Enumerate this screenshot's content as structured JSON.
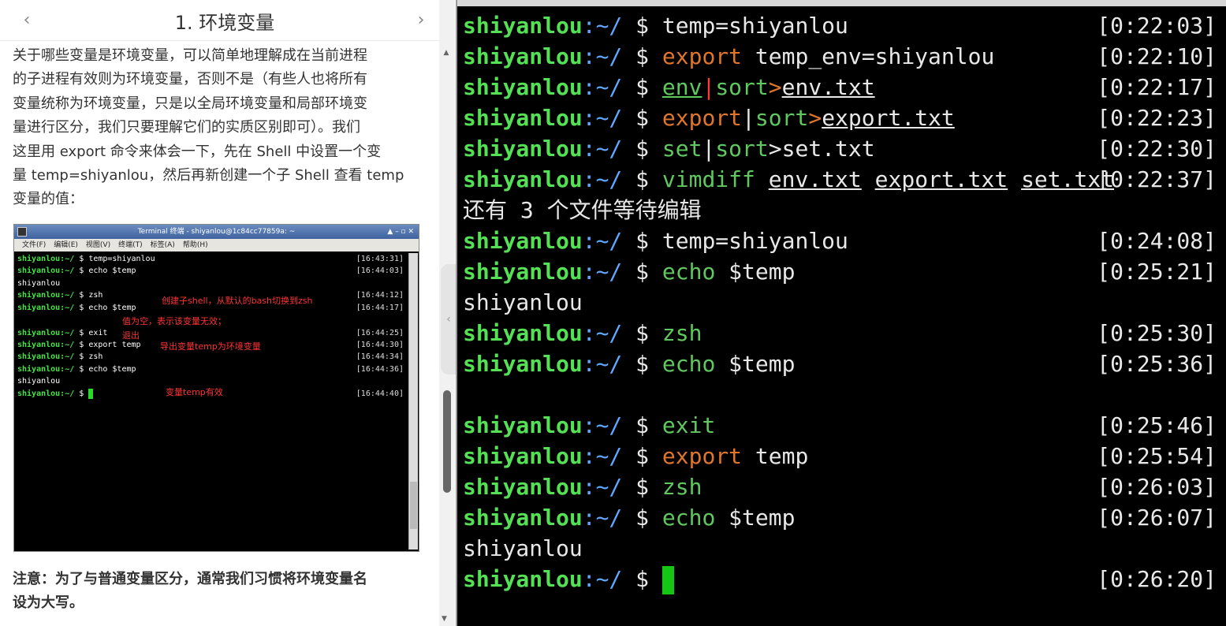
{
  "doc": {
    "title": "1. 环境变量",
    "lines": [
      [
        "关于哪些变量是环境变量，可以简单地理解成在当前进程"
      ],
      [
        "的子进程有效则为环境变量，否则不是（有些人也将所有"
      ],
      [
        "变量统称为环境变量，只是以全局环境变量和局部环境变"
      ],
      [
        "量进行区分，我们只要理解它们的实质区别即可）。我们"
      ],
      [
        "这里用 ",
        "export",
        " 命令来体会一下，先在 Shell 中设置一个变"
      ],
      [
        "量 ",
        "temp=shiyanlou",
        "，然后再新创建一个子 Shell 查看 ",
        "temp"
      ],
      [
        "变量的值："
      ]
    ],
    "note_lines": [
      "注意：为了与普通变量区分，通常我们习惯将环境变量名",
      "设为大写。"
    ]
  },
  "embedded_shot": {
    "window_title": "Terminal 终端 - shiyanlou@1c84cc77859a: ~",
    "menu": [
      "文件(F)",
      "编辑(E)",
      "视图(V)",
      "终端(T)",
      "标签(A)",
      "帮助(H)"
    ],
    "lines": [
      {
        "prompt": "shiyanlou:~/ $ ",
        "cmd": "temp=shiyanlou",
        "ts": "[16:43:31]"
      },
      {
        "prompt": "shiyanlou:~/ $ ",
        "cmd": "echo $temp",
        "ts": "[16:44:03]"
      },
      {
        "prompt": "",
        "cmd": "shiyanlou",
        "ts": ""
      },
      {
        "prompt": "shiyanlou:~/ $ ",
        "cmd": "zsh",
        "ts": "[16:44:12]"
      },
      {
        "prompt": "shiyanlou:~/ $ ",
        "cmd": "echo $temp",
        "ts": "[16:44:17]"
      },
      {
        "prompt": "",
        "cmd": "",
        "ts": ""
      },
      {
        "prompt": "shiyanlou:~/ $ ",
        "cmd": "exit",
        "ts": "[16:44:25]"
      },
      {
        "prompt": "shiyanlou:~/ $ ",
        "cmd": "export temp",
        "ts": "[16:44:30]"
      },
      {
        "prompt": "shiyanlou:~/ $ ",
        "cmd": "zsh",
        "ts": "[16:44:34]"
      },
      {
        "prompt": "shiyanlou:~/ $ ",
        "cmd": "echo $temp",
        "ts": "[16:44:36]"
      },
      {
        "prompt": "",
        "cmd": "shiyanlou",
        "ts": ""
      },
      {
        "prompt": "shiyanlou:~/ $ ",
        "cmd": "",
        "ts": "[16:44:40]"
      }
    ],
    "notes": {
      "zsh": "创建子shell，从默认的bash切换到zsh",
      "empty": "值为空，表示该变量无效；",
      "exit": "退出",
      "export": "导出变量temp为环境变量",
      "valid": "变量temp有效"
    }
  },
  "terminal": {
    "host": "shiyanlou",
    "tilde": ":~/",
    "dollar": "$",
    "lines": [
      {
        "kind": "cmd",
        "parts": [
          [
            "plain",
            "temp=shiyanlou"
          ]
        ],
        "ts": "[0:22:03]"
      },
      {
        "kind": "cmd",
        "parts": [
          [
            "orange",
            "export"
          ],
          [
            "plain",
            " temp_env=shiyanlou"
          ]
        ],
        "ts": "[0:22:10]"
      },
      {
        "kind": "cmd",
        "parts": [
          [
            "green-u",
            "env"
          ],
          [
            "red",
            "|"
          ],
          [
            "green",
            "sort"
          ],
          [
            "orange",
            ">"
          ],
          [
            "plain-u",
            "env.txt"
          ]
        ],
        "ts": "[0:22:17]"
      },
      {
        "kind": "cmd",
        "parts": [
          [
            "orange",
            "export"
          ],
          [
            "plain",
            "|"
          ],
          [
            "green",
            "sort"
          ],
          [
            "orange",
            ">"
          ],
          [
            "plain-u",
            "export.txt"
          ]
        ],
        "ts": "[0:22:23]"
      },
      {
        "kind": "cmd",
        "parts": [
          [
            "green",
            "set"
          ],
          [
            "plain",
            "|"
          ],
          [
            "green",
            "sort"
          ],
          [
            "plain",
            ">set.txt"
          ]
        ],
        "ts": "[0:22:30]"
      },
      {
        "kind": "cmd",
        "parts": [
          [
            "green",
            "vimdiff"
          ],
          [
            "plain",
            " "
          ],
          [
            "plain-u",
            "env.txt"
          ],
          [
            "plain",
            " "
          ],
          [
            "plain-u",
            "export.txt"
          ],
          [
            "plain",
            " "
          ],
          [
            "plain-u",
            "set.txt"
          ]
        ],
        "ts": "[0:22:37]"
      },
      {
        "kind": "out",
        "text": "还有 3 个文件等待编辑"
      },
      {
        "kind": "cmd",
        "parts": [
          [
            "plain",
            "temp=shiyanlou"
          ]
        ],
        "ts": "[0:24:08]"
      },
      {
        "kind": "cmd",
        "parts": [
          [
            "green",
            "echo"
          ],
          [
            "plain",
            " $temp"
          ]
        ],
        "ts": "[0:25:21]"
      },
      {
        "kind": "out",
        "text": "shiyanlou"
      },
      {
        "kind": "cmd",
        "parts": [
          [
            "green",
            "zsh"
          ]
        ],
        "ts": "[0:25:30]"
      },
      {
        "kind": "cmd",
        "parts": [
          [
            "green",
            "echo"
          ],
          [
            "plain",
            " $temp"
          ]
        ],
        "ts": "[0:25:36]"
      },
      {
        "kind": "out",
        "text": ""
      },
      {
        "kind": "cmd",
        "parts": [
          [
            "green",
            "exit"
          ]
        ],
        "ts": "[0:25:46]"
      },
      {
        "kind": "cmd",
        "parts": [
          [
            "orange",
            "export"
          ],
          [
            "plain",
            " temp"
          ]
        ],
        "ts": "[0:25:54]"
      },
      {
        "kind": "cmd",
        "parts": [
          [
            "green",
            "zsh"
          ]
        ],
        "ts": "[0:26:03]"
      },
      {
        "kind": "cmd",
        "parts": [
          [
            "green",
            "echo"
          ],
          [
            "plain",
            " $temp"
          ]
        ],
        "ts": "[0:26:07]"
      },
      {
        "kind": "out",
        "text": "shiyanlou"
      },
      {
        "kind": "cursor",
        "ts": "[0:26:20]"
      }
    ]
  },
  "icons": {
    "prev": "chevron-left-icon",
    "next": "chevron-right-icon",
    "collapse": "chevron-left-icon"
  },
  "colors": {
    "host": "#55e155",
    "tilde": "#5fa8ff",
    "command_green": "#5fc95f",
    "keyword_orange": "#e0762c",
    "pipe_red": "#ff3a3a",
    "inline_code": "#e2426f",
    "cursor": "#15c615"
  }
}
